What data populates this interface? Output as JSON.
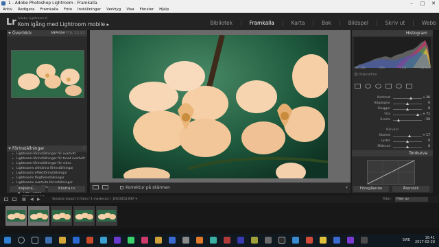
{
  "window": {
    "title": "1 - Adobe Photoshop Lightroom - Framkalla"
  },
  "menu": [
    "Arkiv",
    "Redigera",
    "Framkalla",
    "Foto",
    "Inställningar",
    "Verktyg",
    "Visa",
    "Fönster",
    "Hjälp"
  ],
  "identity": {
    "logo": "Lr",
    "subtitle": "Adobe Lightroom 6",
    "catalog": "Kom igång med Lightroom mobile ▸"
  },
  "modules": [
    "Bibliotek",
    "Framkalla",
    "Karta",
    "Bok",
    "Bildspel",
    "Skriv ut",
    "Webb"
  ],
  "active_module": "Framkalla",
  "navigator": {
    "title": "Överblick",
    "options": [
      "ANPASSA",
      "FYLL",
      "1:1",
      "3:1"
    ]
  },
  "presets": {
    "title": "Förinställningar",
    "items": [
      {
        "label": "Lightroom-förinställningar för svartvitt",
        "type": "folder"
      },
      {
        "label": "Lightroom-förinställningar för tonat svartvitt",
        "type": "folder"
      },
      {
        "label": "Lightroom-förinställningar för video",
        "type": "folder"
      },
      {
        "label": "Lightrooms allmänna förinställningar",
        "type": "folder"
      },
      {
        "label": "Lightrooms effektförinställningar",
        "type": "folder"
      },
      {
        "label": "Lightrooms färgförinställningar",
        "type": "folder"
      },
      {
        "label": "Lightrooms svartvita förinställningar",
        "type": "folder"
      },
      {
        "label": "Användarförinställningar",
        "type": "open"
      },
      {
        "label": "\"HDR\" Video",
        "type": "child"
      },
      {
        "label": "HDR Video 2.0",
        "type": "child"
      },
      {
        "label": "HDR Video 3.0",
        "type": "child"
      }
    ]
  },
  "left_buttons": {
    "copy": "Kopiera...",
    "paste": "Klistra in"
  },
  "toolbar": {
    "proof": "Korrektur på skärmen"
  },
  "histogram": {
    "title": "Histogram",
    "info": [
      "ISO 100",
      "mm",
      "f / 4,0",
      "1/2 sek"
    ],
    "original": "Originalfoto"
  },
  "basic": {
    "rows": [
      {
        "label": "Kontrast",
        "value": "+ 26",
        "pos": 0.63
      },
      {
        "label": "Högdagrar",
        "value": "0",
        "pos": 0.5
      },
      {
        "label": "Skuggor",
        "value": "0",
        "pos": 0.5
      },
      {
        "label": "Vita",
        "value": "+ 71",
        "pos": 0.85
      },
      {
        "label": "Svarta",
        "value": "- 59",
        "pos": 0.2
      }
    ],
    "presence_title": "Närvaro",
    "presence": [
      {
        "label": "Klarhet",
        "value": "+ 17",
        "pos": 0.58
      },
      {
        "label": "Lyster",
        "value": "0",
        "pos": 0.5
      },
      {
        "label": "Mättnad",
        "value": "0",
        "pos": 0.5
      }
    ]
  },
  "tone_curve": {
    "title": "Tonkurva"
  },
  "right_buttons": {
    "previous": "Föregående",
    "reset": "Återställ"
  },
  "filmbar": {
    "info": "Senaste import   5 foton / 1 markerad / _DSC8152.NEF ▾",
    "filter_label": "Filter:",
    "filter_value": "Filter av"
  },
  "filmstrip_count": 5,
  "taskbar": {
    "lang": "SWE",
    "time": "16:41",
    "date": "2017-02-28"
  },
  "colors": {
    "accent": "#ffffff",
    "panel": "#2b2b2b",
    "petal": "#f6cfa6"
  }
}
